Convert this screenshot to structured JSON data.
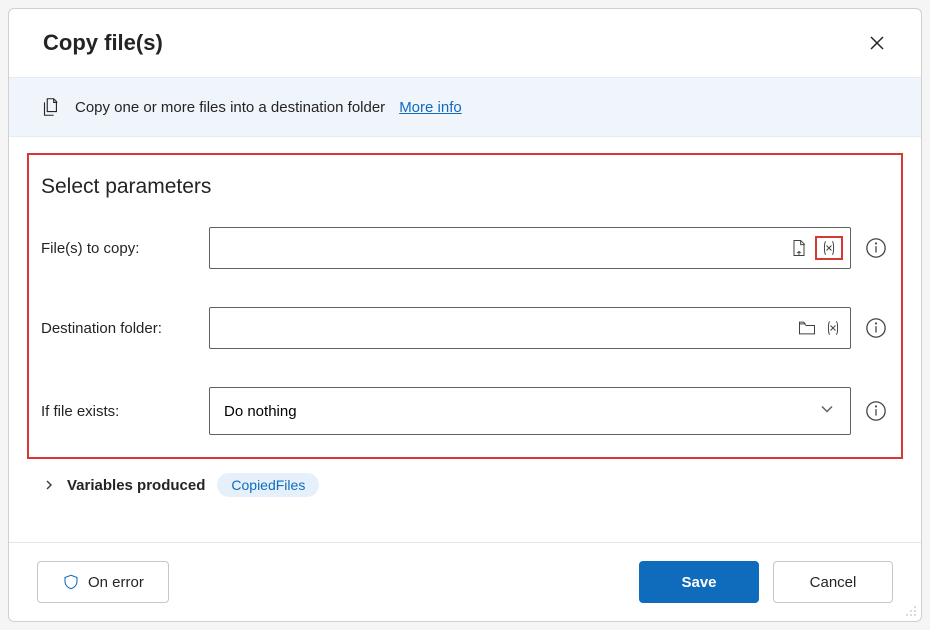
{
  "dialog": {
    "title": "Copy file(s)"
  },
  "banner": {
    "text": "Copy one or more files into a destination folder",
    "more_info": "More info"
  },
  "params": {
    "section_title": "Select parameters",
    "files_to_copy_label": "File(s) to copy:",
    "files_to_copy_value": "",
    "destination_label": "Destination folder:",
    "destination_value": "",
    "if_exists_label": "If file exists:",
    "if_exists_value": "Do nothing"
  },
  "variables": {
    "label": "Variables produced",
    "chip": "CopiedFiles"
  },
  "footer": {
    "on_error": "On error",
    "save": "Save",
    "cancel": "Cancel"
  }
}
